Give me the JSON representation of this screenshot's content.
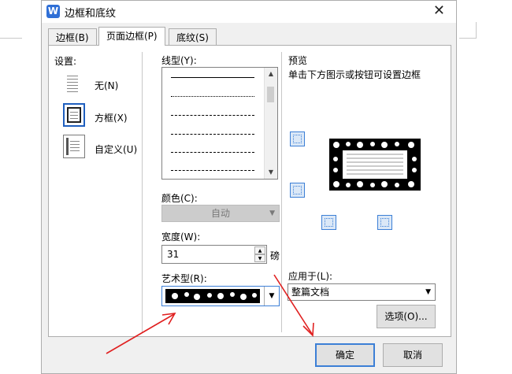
{
  "window": {
    "app_icon_letter": "W",
    "title": "边框和底纹",
    "close_icon": "close-icon"
  },
  "tabs": [
    {
      "label": "边框(B)",
      "active": false
    },
    {
      "label": "页面边框(P)",
      "active": true
    },
    {
      "label": "底纹(S)",
      "active": false
    }
  ],
  "settings": {
    "label": "设置:",
    "options": [
      {
        "label": "无(N)",
        "selected": false
      },
      {
        "label": "方框(X)",
        "selected": true
      },
      {
        "label": "自定义(U)",
        "selected": false
      }
    ]
  },
  "line_style": {
    "label": "线型(Y):"
  },
  "color": {
    "label": "颜色(C):",
    "value": "自动",
    "enabled": false
  },
  "width": {
    "label": "宽度(W):",
    "value": "31",
    "unit": "磅"
  },
  "art": {
    "label": "艺术型(R):"
  },
  "preview": {
    "label": "预览",
    "hint": "单击下方图示或按钮可设置边框"
  },
  "apply_to": {
    "label": "应用于(L):",
    "value": "整篇文档"
  },
  "buttons": {
    "options": "选项(O)...",
    "ok": "确定",
    "cancel": "取消"
  },
  "colors": {
    "accent": "#3c7fd6",
    "arrow": "#e02020",
    "panel_bg": "#ffffff",
    "dialog_bg": "#f0f0f0"
  }
}
